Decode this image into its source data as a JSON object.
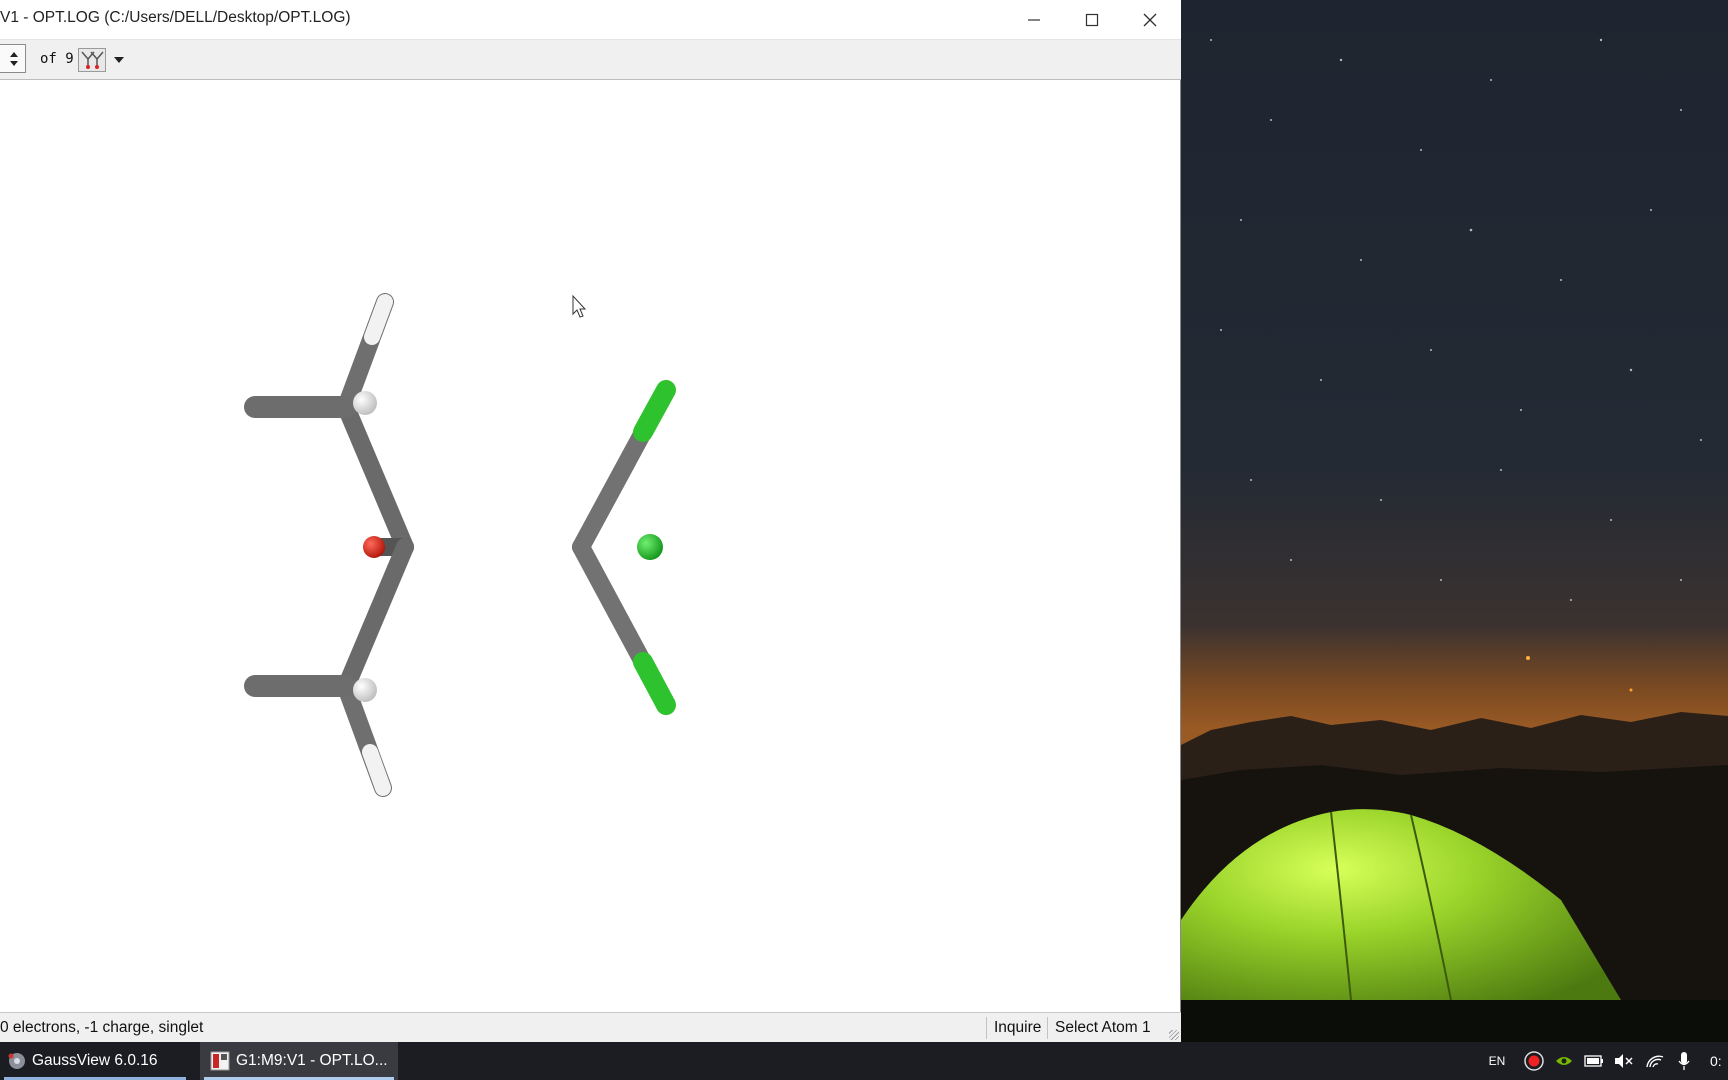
{
  "window": {
    "title": "V1 - OPT.LOG (C:/Users/DELL/Desktop/OPT.LOG)"
  },
  "toolbar": {
    "of_label": "of 9"
  },
  "status": {
    "left": "0 electrons, -1 charge, singlet",
    "mode": "Inquire",
    "hint": "Select Atom 1"
  },
  "taskbar": {
    "app1_label": "GaussView 6.0.16",
    "app2_label": "G1:M9:V1 - OPT.LO...",
    "lang": "EN",
    "clock": "0:"
  },
  "colors": {
    "carbon": "#8c8c8c",
    "hydrogen": "#f0f0f0",
    "oxygen": "#e02818",
    "chlorine": "#2ec22e",
    "taskbar": "#1c1d22"
  }
}
